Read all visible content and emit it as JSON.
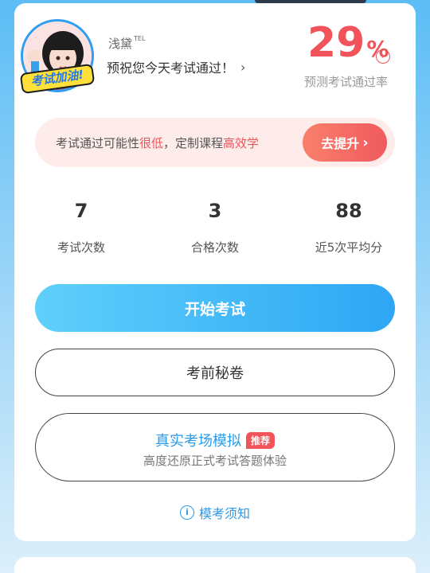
{
  "profile": {
    "username": "浅黛",
    "username_tag": "TEL",
    "predict_text": "预祝您今天考试通过！",
    "avatar_badge": "考试加油!"
  },
  "pass_rate": {
    "value": "29",
    "unit": "%",
    "label": "预测考试通过率",
    "color": "#f0535a"
  },
  "banner": {
    "text_1": "考试通过可能性",
    "text_hl_1": "很低",
    "text_2": "，定制课程",
    "text_hl_2": "高效学",
    "button_label": "去提升"
  },
  "stats": [
    {
      "value": "7",
      "label": "考试次数"
    },
    {
      "value": "3",
      "label": "合格次数"
    },
    {
      "value": "88",
      "label": "近5次平均分"
    }
  ],
  "actions": {
    "start_label": "开始考试",
    "secret_label": "考前秘卷",
    "sim_title": "真实考场模拟",
    "sim_tag": "推荐",
    "sim_subtitle": "高度还原正式考试答题体验",
    "notice_label": "模考须知"
  },
  "icons": {
    "chevron": "chevron-right-icon",
    "info": "info-icon"
  },
  "colors": {
    "accent_blue": "#2ea6f4",
    "accent_red": "#f0535a"
  }
}
